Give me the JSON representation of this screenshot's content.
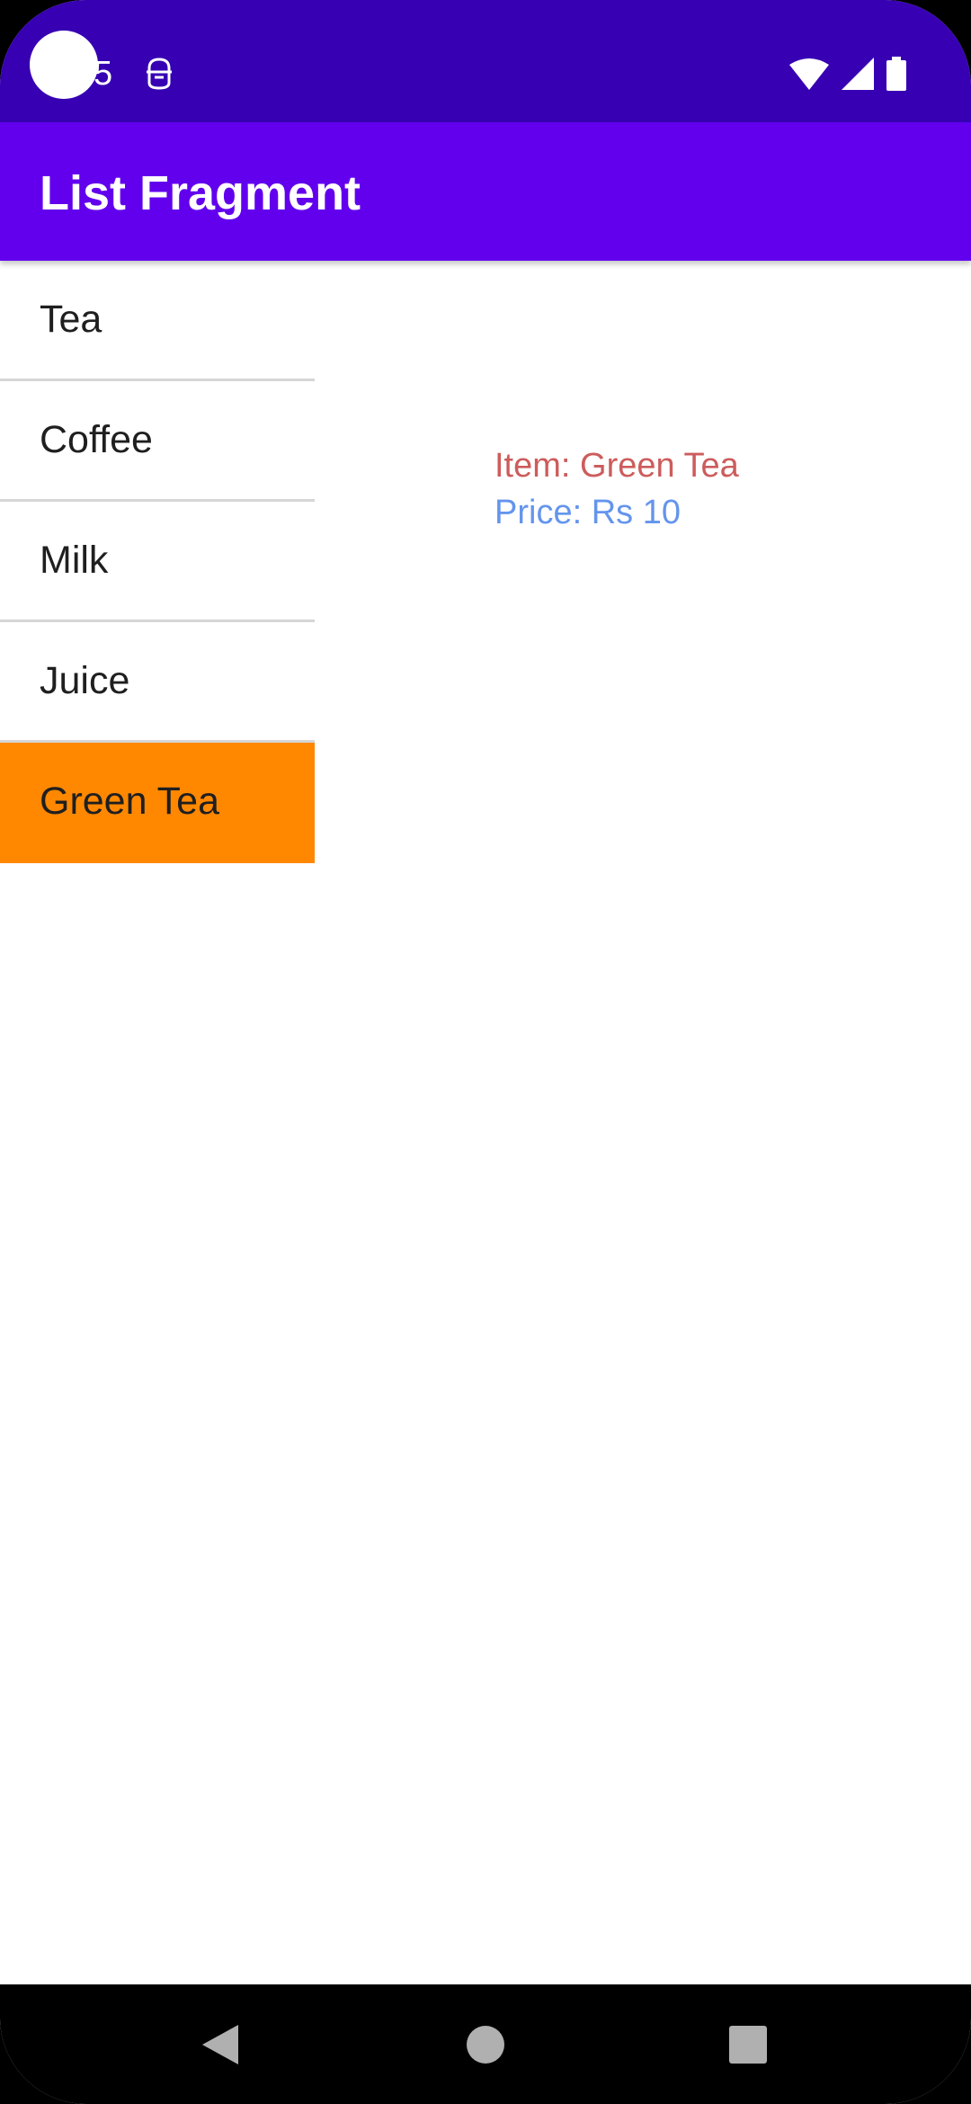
{
  "status_bar": {
    "time": "5",
    "background": "#3700B3"
  },
  "app_bar": {
    "title": "List Fragment",
    "background": "#6200EE"
  },
  "list": {
    "items": [
      {
        "label": "Tea",
        "selected": false
      },
      {
        "label": "Coffee",
        "selected": false
      },
      {
        "label": "Milk",
        "selected": false
      },
      {
        "label": "Juice",
        "selected": false
      },
      {
        "label": "Green Tea",
        "selected": true
      }
    ],
    "selected_color": "#FF8800"
  },
  "detail": {
    "item_text": "Item: Green Tea",
    "price_text": "Price: Rs 10",
    "item_color": "#CD5C5C",
    "price_color": "#6495ED"
  },
  "nav_bar": {
    "buttons": [
      "back-icon",
      "home-icon",
      "recents-icon"
    ]
  }
}
